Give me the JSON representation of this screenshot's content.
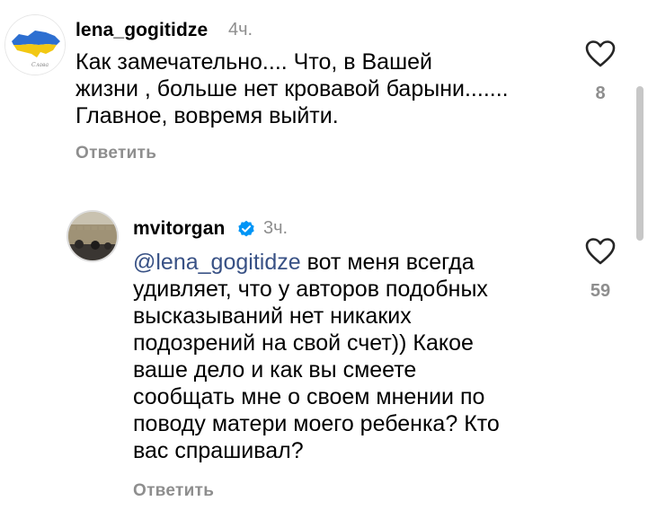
{
  "comment1": {
    "username": "lena_gogitidze",
    "time": "4ч.",
    "lines": [
      "Как замечательно.... Что, в Вашей",
      "жизни , больше нет кровавой барыни.......",
      "Главное, вовремя выйти."
    ],
    "reply_label": "Ответить",
    "likes": "8",
    "avatar_icon": "ukraine-map-icon"
  },
  "comment2": {
    "username": "mvitorgan",
    "time": "3ч.",
    "mention": "@lena_gogitidze",
    "lines": [
      "вот меня всегда",
      "удивляет, что у авторов подобных",
      "высказываний нет никаких",
      "подозрений на свой счет)) Какое",
      "ваше дело и как вы смеете",
      "сообщать мне о своем мнении по",
      "поводу матери моего ребенка? Кто",
      "вас спрашивал?"
    ],
    "reply_label": "Ответить",
    "likes": "59",
    "verified_icon": "verified-badge-icon"
  },
  "colors": {
    "secondary_text": "#8e8e8e",
    "mention": "#385185",
    "verified": "#0095f6"
  }
}
